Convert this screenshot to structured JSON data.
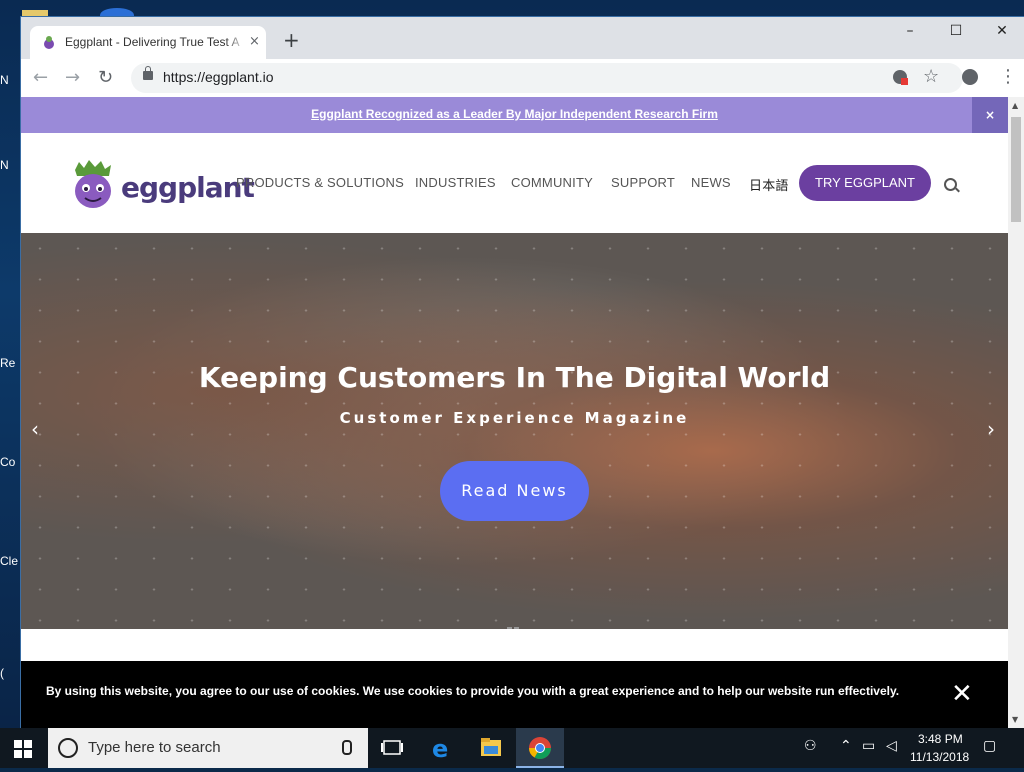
{
  "browser": {
    "tab_title": "Eggplant - Delivering True Test A",
    "tab_close": "×",
    "new_tab": "+",
    "window_controls": {
      "minimize": "–",
      "maximize": "☐",
      "close": "✕"
    },
    "nav": {
      "back": "←",
      "forward": "→",
      "reload": "↻"
    },
    "url": "https://eggplant.io",
    "star": "☆",
    "menu": "⋮"
  },
  "site": {
    "announcement": "Eggplant Recognized as a Leader By Major Independent Research Firm",
    "announcement_close": "×",
    "logo_text": "eggplant",
    "nav_items": [
      {
        "label": "PRODUCTS & SOLUTIONS"
      },
      {
        "label": "INDUSTRIES"
      },
      {
        "label": "COMMUNITY"
      },
      {
        "label": "SUPPORT"
      },
      {
        "label": "NEWS"
      },
      {
        "label": "日本語"
      }
    ],
    "cta": "TRY EGGPLANT",
    "hero": {
      "title": "Keeping Customers In The Digital World",
      "subtitle": "Customer Experience Magazine",
      "button": "Read News",
      "prev": "‹",
      "next": "›"
    },
    "cookie": {
      "text": "By using this website, you agree to our use of cookies. We use cookies to provide you with a great experience and to help our website run effectively.",
      "close": "✕"
    }
  },
  "desktop": {
    "labels": [
      "N",
      "N",
      "Re",
      "Co",
      "Cle",
      "("
    ]
  },
  "taskbar": {
    "search_placeholder": "Type here to search",
    "time": "3:48 PM",
    "date": "11/13/2018"
  },
  "colors": {
    "announcement_bg": "#9a8ad8",
    "cta_bg": "#6b3fa0",
    "hero_button": "#5b6ef2",
    "logo_text": "#4a3b7c"
  }
}
